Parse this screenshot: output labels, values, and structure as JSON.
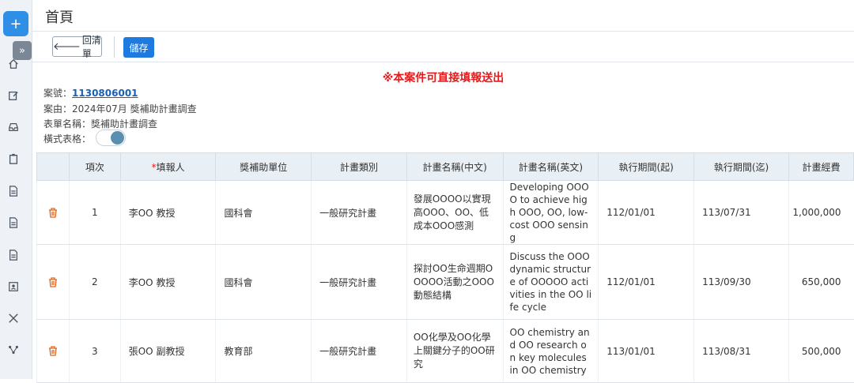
{
  "page": {
    "title": "首頁"
  },
  "sidebar": {
    "add_label": "+",
    "expand_label": "»",
    "icons": [
      "home-icon",
      "edit-icon",
      "inbox-icon",
      "clipboard-icon",
      "document-icon",
      "document-icon",
      "document-icon",
      "contact-icon",
      "tools-icon",
      "network-icon"
    ]
  },
  "toolbar": {
    "back_label": "回清單",
    "save_label": "儲存"
  },
  "notice": "※本案件可直接填報送出",
  "info": {
    "case_no_label": "案號：",
    "case_no": "1130806001",
    "reason": "案由：2024年07月 獎補助計畫調查",
    "form_name": "表單名稱：獎補助計畫調查",
    "landscape_label": "橫式表格："
  },
  "table": {
    "headers": [
      "",
      "項次",
      "填報人",
      "獎補助單位",
      "計畫類別",
      "計畫名稱(中文)",
      "計畫名稱(英文)",
      "執行期間(起)",
      "執行期間(迄)",
      "計畫經費"
    ],
    "required_mark": "*",
    "rows": [
      {
        "no": "1",
        "reporter": "李OO 教授",
        "unit": "國科會",
        "category": "一般研究計畫",
        "name_zh": "發展OOOO以實現高OOO、OO、低成本OOO感測",
        "name_en": "Developing OOOO to achieve high OOO, OO, low-cost OOO sensing",
        "start": "112/01/01",
        "end": "113/07/31",
        "budget": "1,000,000"
      },
      {
        "no": "2",
        "reporter": "李OO 教授",
        "unit": "國科會",
        "category": "一般研究計畫",
        "name_zh": "探討OO生命週期OOOOO活動之OOO動態結構",
        "name_en": "Discuss the OOO dynamic structure of OOOOO activities in the OO life cycle",
        "start": "112/01/01",
        "end": "113/09/30",
        "budget": "650,000"
      },
      {
        "no": "3",
        "reporter": "張OO 副教授",
        "unit": "教育部",
        "category": "一般研究計畫",
        "name_zh": "OO化學及OO化學上關鍵分子的OO研究",
        "name_en": "OO chemistry and OO research on key molecules in OO chemistry",
        "start": "113/01/01",
        "end": "113/08/31",
        "budget": "500,000"
      }
    ]
  }
}
